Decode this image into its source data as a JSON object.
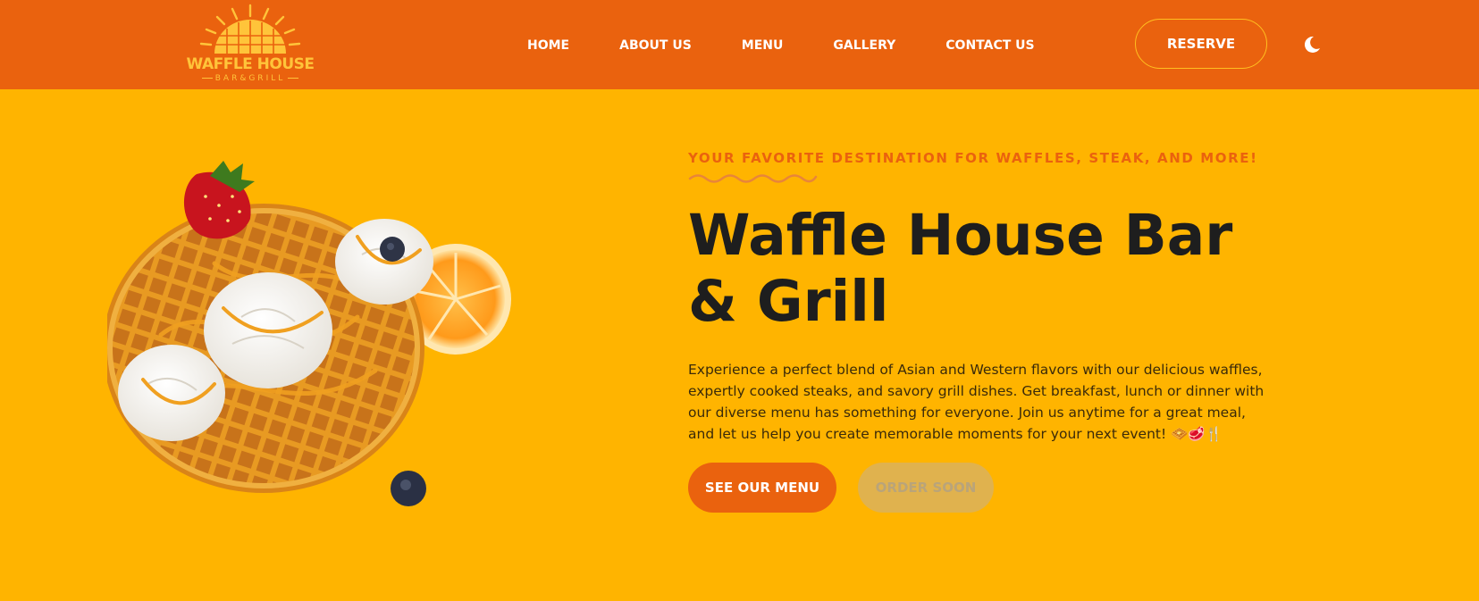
{
  "brand": {
    "name": "WAFFLE HOUSE",
    "subtitle": "BAR&GRILL"
  },
  "nav": {
    "items": [
      {
        "label": "HOME"
      },
      {
        "label": "ABOUT US"
      },
      {
        "label": "MENU"
      },
      {
        "label": "GALLERY"
      },
      {
        "label": "CONTACT US"
      }
    ],
    "reserve_label": "RESERVE",
    "theme_icon": "moon-icon"
  },
  "hero": {
    "tagline": "YOUR FAVORITE DESTINATION FOR WAFFLES, STEAK, AND MORE!",
    "title": "Waffle House Bar & Grill",
    "description": "Experience a perfect blend of Asian and Western flavors with our delicious waffles, expertly cooked steaks, and savory grill dishes. Get breakfast, lunch or dinner with our diverse menu has something for everyone. Join us anytime for a great meal, and let us help you create memorable moments for your next event! 🧇🥩🍴",
    "image": "waffle-with-whipped-cream-strawberry-orange-blueberries",
    "cta_primary": "SEE OUR MENU",
    "cta_secondary": "ORDER SOON"
  },
  "colors": {
    "navbar": "#EA620E",
    "background": "#FFB400",
    "accent": "#EA620E",
    "title": "#1E1E1E",
    "logo": "#FFC43A"
  }
}
